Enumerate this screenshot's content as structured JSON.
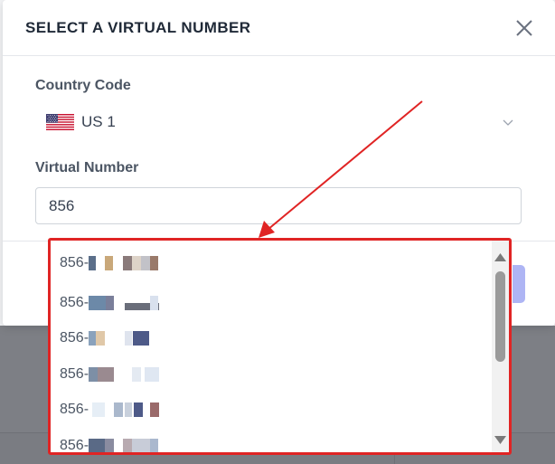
{
  "modal": {
    "title": "SELECT A VIRTUAL NUMBER",
    "close_icon": "close-icon"
  },
  "country": {
    "label": "Country Code",
    "flag_icon": "us-flag-icon",
    "value": "US 1",
    "chevron_icon": "chevron-down-icon"
  },
  "virtual_number": {
    "label": "Virtual Number",
    "value": "856"
  },
  "dropdown": {
    "border_color": "#e02424",
    "items": [
      {
        "prefix": "856-"
      },
      {
        "prefix": "856-"
      },
      {
        "prefix": "856-"
      },
      {
        "prefix": "856-"
      },
      {
        "prefix": "856-"
      },
      {
        "prefix": "856-"
      }
    ],
    "scroll_up_icon": "triangle-up-icon",
    "scroll_down_icon": "triangle-down-icon"
  },
  "annotation": {
    "arrow_color": "#e02424"
  },
  "colors": {
    "accent": "#aeb5f4",
    "text": "#374151",
    "label": "#4b5563"
  }
}
